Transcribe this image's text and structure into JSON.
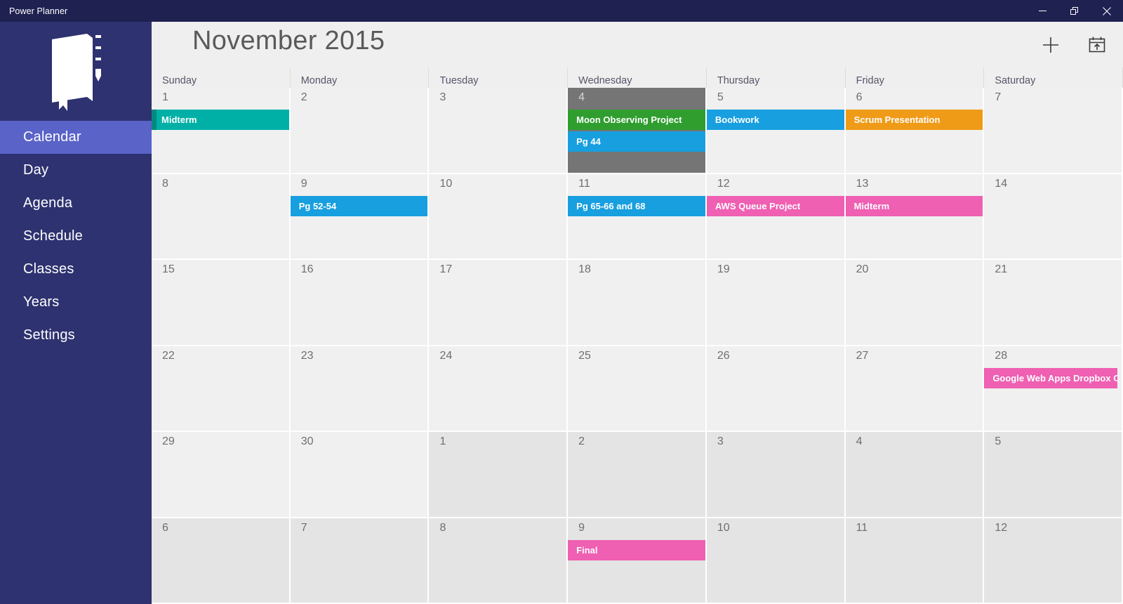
{
  "window": {
    "title": "Power Planner",
    "controls": [
      {
        "name": "minimize",
        "label": "Minimize"
      },
      {
        "name": "restore",
        "label": "Restore"
      },
      {
        "name": "close",
        "label": "Close"
      }
    ]
  },
  "sidebar": {
    "logo_name": "notebook-pencil-logo",
    "items": [
      {
        "label": "Calendar",
        "active": true
      },
      {
        "label": "Day",
        "active": false
      },
      {
        "label": "Agenda",
        "active": false
      },
      {
        "label": "Schedule",
        "active": false
      },
      {
        "label": "Classes",
        "active": false
      },
      {
        "label": "Years",
        "active": false
      },
      {
        "label": "Settings",
        "active": false
      }
    ]
  },
  "header": {
    "month_title": "November 2015",
    "add_label": "+",
    "add_icon": "plus-icon",
    "today_icon": "calendar-today-icon"
  },
  "calendar": {
    "weekdays": [
      "Sunday",
      "Monday",
      "Tuesday",
      "Wednesday",
      "Thursday",
      "Friday",
      "Saturday"
    ],
    "colors": {
      "teal": "#00b0a6",
      "green": "#2f9e2f",
      "blue": "#179fe0",
      "orange": "#ef9b18",
      "pink": "#ef5fb2",
      "today_bg": "#757575",
      "cell_bg": "#f0f0f0",
      "other_month_bg": "#e4e4e4",
      "sidebar_bg": "#2e3270",
      "sidebar_active": "#5a63c8",
      "titlebar_bg": "#1f2151"
    },
    "weeks": [
      [
        {
          "num": "1",
          "other_month": false,
          "today": false,
          "events": [
            {
              "title": "Midterm",
              "color": "#00b0a6",
              "accent": true
            }
          ]
        },
        {
          "num": "2",
          "other_month": false,
          "today": false,
          "events": []
        },
        {
          "num": "3",
          "other_month": false,
          "today": false,
          "events": []
        },
        {
          "num": "4",
          "other_month": false,
          "today": true,
          "events": [
            {
              "title": "Moon Observing Project",
              "color": "#2f9e2f",
              "accent": false
            },
            {
              "title": "Pg 44",
              "color": "#179fe0",
              "accent": false
            }
          ]
        },
        {
          "num": "5",
          "other_month": false,
          "today": false,
          "events": [
            {
              "title": "Bookwork",
              "color": "#179fe0",
              "accent": false
            }
          ]
        },
        {
          "num": "6",
          "other_month": false,
          "today": false,
          "events": [
            {
              "title": "Scrum Presentation",
              "color": "#ef9b18",
              "accent": false
            }
          ]
        },
        {
          "num": "7",
          "other_month": false,
          "today": false,
          "events": []
        }
      ],
      [
        {
          "num": "8",
          "other_month": false,
          "today": false,
          "events": []
        },
        {
          "num": "9",
          "other_month": false,
          "today": false,
          "events": [
            {
              "title": "Pg 52-54",
              "color": "#179fe0",
              "accent": false
            }
          ]
        },
        {
          "num": "10",
          "other_month": false,
          "today": false,
          "events": []
        },
        {
          "num": "11",
          "other_month": false,
          "today": false,
          "events": [
            {
              "title": "Pg 65-66 and 68",
              "color": "#179fe0",
              "accent": false
            }
          ]
        },
        {
          "num": "12",
          "other_month": false,
          "today": false,
          "events": [
            {
              "title": "AWS Queue Project",
              "color": "#ef5fb2",
              "accent": false
            }
          ]
        },
        {
          "num": "13",
          "other_month": false,
          "today": false,
          "events": [
            {
              "title": "Midterm",
              "color": "#ef5fb2",
              "accent": false
            }
          ]
        },
        {
          "num": "14",
          "other_month": false,
          "today": false,
          "events": []
        }
      ],
      [
        {
          "num": "15",
          "other_month": false,
          "today": false,
          "events": []
        },
        {
          "num": "16",
          "other_month": false,
          "today": false,
          "events": []
        },
        {
          "num": "17",
          "other_month": false,
          "today": false,
          "events": []
        },
        {
          "num": "18",
          "other_month": false,
          "today": false,
          "events": []
        },
        {
          "num": "19",
          "other_month": false,
          "today": false,
          "events": []
        },
        {
          "num": "20",
          "other_month": false,
          "today": false,
          "events": []
        },
        {
          "num": "21",
          "other_month": false,
          "today": false,
          "events": []
        }
      ],
      [
        {
          "num": "22",
          "other_month": false,
          "today": false,
          "events": []
        },
        {
          "num": "23",
          "other_month": false,
          "today": false,
          "events": []
        },
        {
          "num": "24",
          "other_month": false,
          "today": false,
          "events": []
        },
        {
          "num": "25",
          "other_month": false,
          "today": false,
          "events": []
        },
        {
          "num": "26",
          "other_month": false,
          "today": false,
          "events": []
        },
        {
          "num": "27",
          "other_month": false,
          "today": false,
          "events": []
        },
        {
          "num": "28",
          "other_month": false,
          "today": false,
          "events": [
            {
              "title": "Google Web Apps Dropbox Client",
              "color": "#ef5fb2",
              "accent": false,
              "clipped": true
            }
          ]
        }
      ],
      [
        {
          "num": "29",
          "other_month": false,
          "today": false,
          "events": []
        },
        {
          "num": "30",
          "other_month": false,
          "today": false,
          "events": []
        },
        {
          "num": "1",
          "other_month": true,
          "today": false,
          "events": []
        },
        {
          "num": "2",
          "other_month": true,
          "today": false,
          "events": []
        },
        {
          "num": "3",
          "other_month": true,
          "today": false,
          "events": []
        },
        {
          "num": "4",
          "other_month": true,
          "today": false,
          "events": []
        },
        {
          "num": "5",
          "other_month": true,
          "today": false,
          "events": []
        }
      ],
      [
        {
          "num": "6",
          "other_month": true,
          "today": false,
          "events": []
        },
        {
          "num": "7",
          "other_month": true,
          "today": false,
          "events": []
        },
        {
          "num": "8",
          "other_month": true,
          "today": false,
          "events": []
        },
        {
          "num": "9",
          "other_month": true,
          "today": false,
          "events": [
            {
              "title": "Final",
              "color": "#ef5fb2",
              "accent": false
            }
          ]
        },
        {
          "num": "10",
          "other_month": true,
          "today": false,
          "events": []
        },
        {
          "num": "11",
          "other_month": true,
          "today": false,
          "events": []
        },
        {
          "num": "12",
          "other_month": true,
          "today": false,
          "events": []
        }
      ]
    ]
  }
}
